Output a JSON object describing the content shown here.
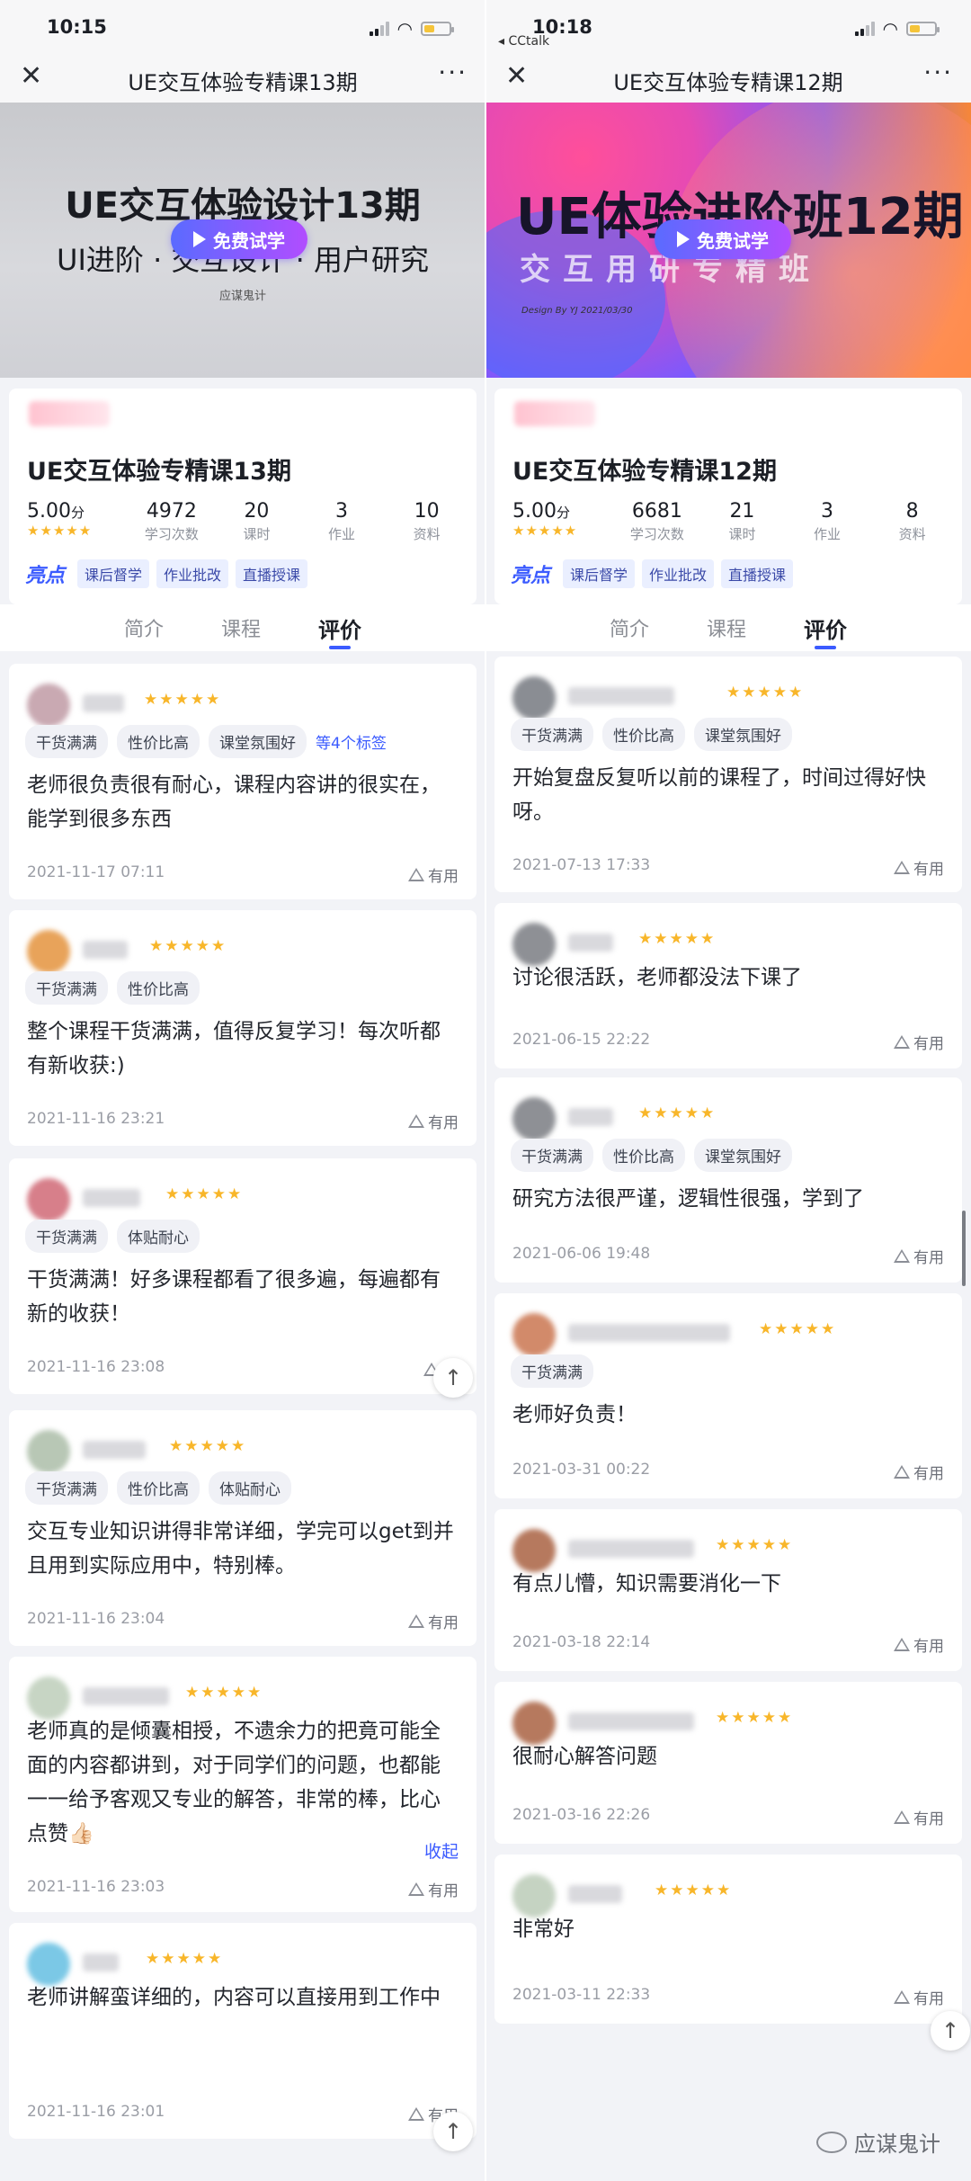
{
  "left": {
    "status_time": "10:15",
    "carrier": "",
    "nav_title": "UE交互体验专精课13期",
    "banner": {
      "title": "UE交互体验设计13期",
      "subtitle": "UI进阶 · 交互设计 · 用户研究",
      "logo_text": "应谋鬼计",
      "design_credit": "",
      "trial_label": "免费试学"
    },
    "course": {
      "title": "UE交互体验专精课13期",
      "stats": [
        {
          "value": "5.00",
          "unit": "分",
          "label": ""
        },
        {
          "value": "4972",
          "label": "学习次数"
        },
        {
          "value": "20",
          "label": "课时"
        },
        {
          "value": "3",
          "label": "作业"
        },
        {
          "value": "10",
          "label": "资料"
        }
      ],
      "rating": 5,
      "highlight_label": "亮点",
      "tags": [
        "课后督学",
        "作业批改",
        "直播授课"
      ]
    },
    "tabs": [
      "简介",
      "课程",
      "评价"
    ],
    "active_tab": "评价",
    "reviews": [
      {
        "tags": [
          "干货满满",
          "性价比高",
          "课堂氛围好"
        ],
        "more_tags": "等4个标签",
        "text": "老师很负责很有耐心，课程内容讲的很实在，能学到很多东西",
        "date": "2021-11-17 07:11",
        "useful": "有用",
        "collapse": ""
      },
      {
        "tags": [
          "干货满满",
          "性价比高"
        ],
        "more_tags": "",
        "text": "整个课程干货满满，值得反复学习！每次听都有新收获:)",
        "date": "2021-11-16 23:21",
        "useful": "有用",
        "collapse": ""
      },
      {
        "tags": [
          "干货满满",
          "体贴耐心"
        ],
        "more_tags": "",
        "text": "干货满满！好多课程都看了很多遍，每遍都有新的收获！",
        "date": "2021-11-16 23:08",
        "useful": "有",
        "collapse": ""
      },
      {
        "tags": [
          "干货满满",
          "性价比高",
          "体贴耐心"
        ],
        "more_tags": "",
        "text": "交互专业知识讲得非常详细，学完可以get到并且用到实际应用中，特别棒。",
        "date": "2021-11-16 23:04",
        "useful": "有用",
        "collapse": ""
      },
      {
        "tags": [],
        "more_tags": "",
        "text": "老师真的是倾囊相授，不遗余力的把竟可能全面的内容都讲到，对于同学们的问题，也都能一一给予客观又专业的解答，非常的棒，比心点赞👍🏻",
        "date": "2021-11-16 23:03",
        "useful": "有用",
        "collapse": "收起"
      },
      {
        "tags": [],
        "more_tags": "",
        "text": "老师讲解蛮详细的，内容可以直接用到工作中",
        "date": "2021-11-16 23:01",
        "useful": "有用",
        "collapse": ""
      }
    ]
  },
  "right": {
    "status_time": "10:18",
    "carrier": "◂ CCtalk",
    "nav_title": "UE交互体验专精课12期",
    "banner": {
      "title": "UE体验进阶班12期",
      "subtitle": "交互用研专精班",
      "logo_text": "",
      "design_credit": "Design By YJ 2021/03/30",
      "trial_label": "免费试学"
    },
    "course": {
      "title": "UE交互体验专精课12期",
      "stats": [
        {
          "value": "5.00",
          "unit": "分",
          "label": ""
        },
        {
          "value": "6681",
          "label": "学习次数"
        },
        {
          "value": "21",
          "label": "课时"
        },
        {
          "value": "3",
          "label": "作业"
        },
        {
          "value": "8",
          "label": "资料"
        }
      ],
      "rating": 5,
      "highlight_label": "亮点",
      "tags": [
        "课后督学",
        "作业批改",
        "直播授课"
      ]
    },
    "tabs": [
      "简介",
      "课程",
      "评价"
    ],
    "active_tab": "评价",
    "reviews": [
      {
        "tags": [
          "干货满满",
          "性价比高",
          "课堂氛围好"
        ],
        "more_tags": "",
        "text": "开始复盘反复听以前的课程了，时间过得好快呀。",
        "date": "2021-07-13 17:33",
        "useful": "有用",
        "collapse": ""
      },
      {
        "tags": [],
        "more_tags": "",
        "text": "讨论很活跃，老师都没法下课了",
        "date": "2021-06-15 22:22",
        "useful": "有用",
        "collapse": ""
      },
      {
        "tags": [
          "干货满满",
          "性价比高",
          "课堂氛围好"
        ],
        "more_tags": "",
        "text": "研究方法很严谨，逻辑性很强，学到了",
        "date": "2021-06-06 19:48",
        "useful": "有用",
        "collapse": ""
      },
      {
        "tags": [
          "干货满满"
        ],
        "more_tags": "",
        "text": "老师好负责！",
        "date": "2021-03-31 00:22",
        "useful": "有用",
        "collapse": ""
      },
      {
        "tags": [],
        "more_tags": "",
        "text": "有点儿懵，知识需要消化一下",
        "date": "2021-03-18 22:14",
        "useful": "有用",
        "collapse": ""
      },
      {
        "tags": [],
        "more_tags": "",
        "text": "很耐心解答问题",
        "date": "2021-03-16 22:26",
        "useful": "有用",
        "collapse": ""
      },
      {
        "tags": [],
        "more_tags": "",
        "text": "非常好",
        "date": "2021-03-11 22:33",
        "useful": "有用",
        "collapse": ""
      }
    ],
    "watermark": "应谋鬼计"
  },
  "colors": {
    "accent": "#3b5bff",
    "star": "#f8b62a",
    "battery": "#f5c43a"
  },
  "icons": [
    "close-icon",
    "more-icon",
    "play-icon",
    "star-icon",
    "thumb-up-icon",
    "arrow-up-icon",
    "wechat-icon"
  ]
}
